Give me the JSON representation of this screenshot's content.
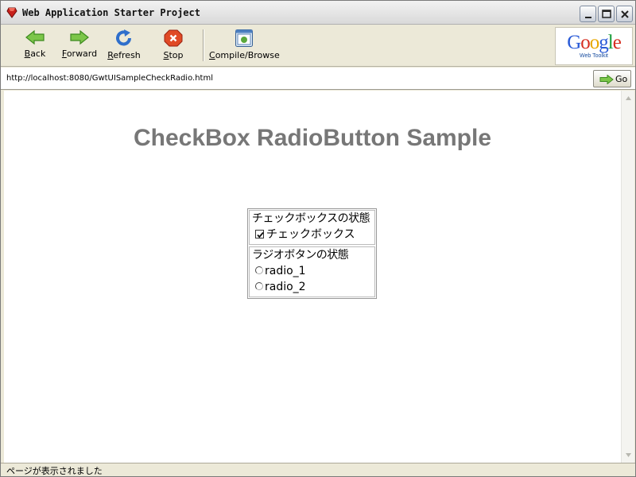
{
  "window": {
    "title": "Web Application Starter Project",
    "icon": "ruby-gem-icon"
  },
  "toolbar": {
    "buttons": [
      {
        "label_key": "B",
        "label_rest": "ack",
        "icon": "arrow-left-icon"
      },
      {
        "label_key": "F",
        "label_rest": "orward",
        "icon": "arrow-right-icon"
      },
      {
        "label_key": "R",
        "label_rest": "efresh",
        "icon": "refresh-icon"
      },
      {
        "label_key": "S",
        "label_rest": "top",
        "icon": "stop-icon"
      },
      {
        "label_key": "C",
        "label_rest": "ompile/Browse",
        "icon": "compile-browse-icon"
      }
    ],
    "logo": {
      "word": "Google",
      "sub": "Web Toolkit"
    }
  },
  "address": {
    "url": "http://localhost:8080/GwtUISampleCheckRadio.html",
    "go_label": "Go"
  },
  "page": {
    "title": "CheckBox RadioButton Sample",
    "checkbox_group": {
      "title": "チェックボックスの状態",
      "checkbox_label": "チェックボックス",
      "checked": true
    },
    "radio_group": {
      "title": "ラジオボタンの状態",
      "options": [
        {
          "label": "radio_1",
          "selected": false
        },
        {
          "label": "radio_2",
          "selected": false
        }
      ]
    }
  },
  "status": {
    "text": "ページが表示されました"
  },
  "colors": {
    "title_gray": "#777777",
    "toolbar_bg": "#ece9d8",
    "arrow_green": "#58b030",
    "stop_red": "#d63b1f",
    "refresh_blue": "#2f6fcb"
  }
}
